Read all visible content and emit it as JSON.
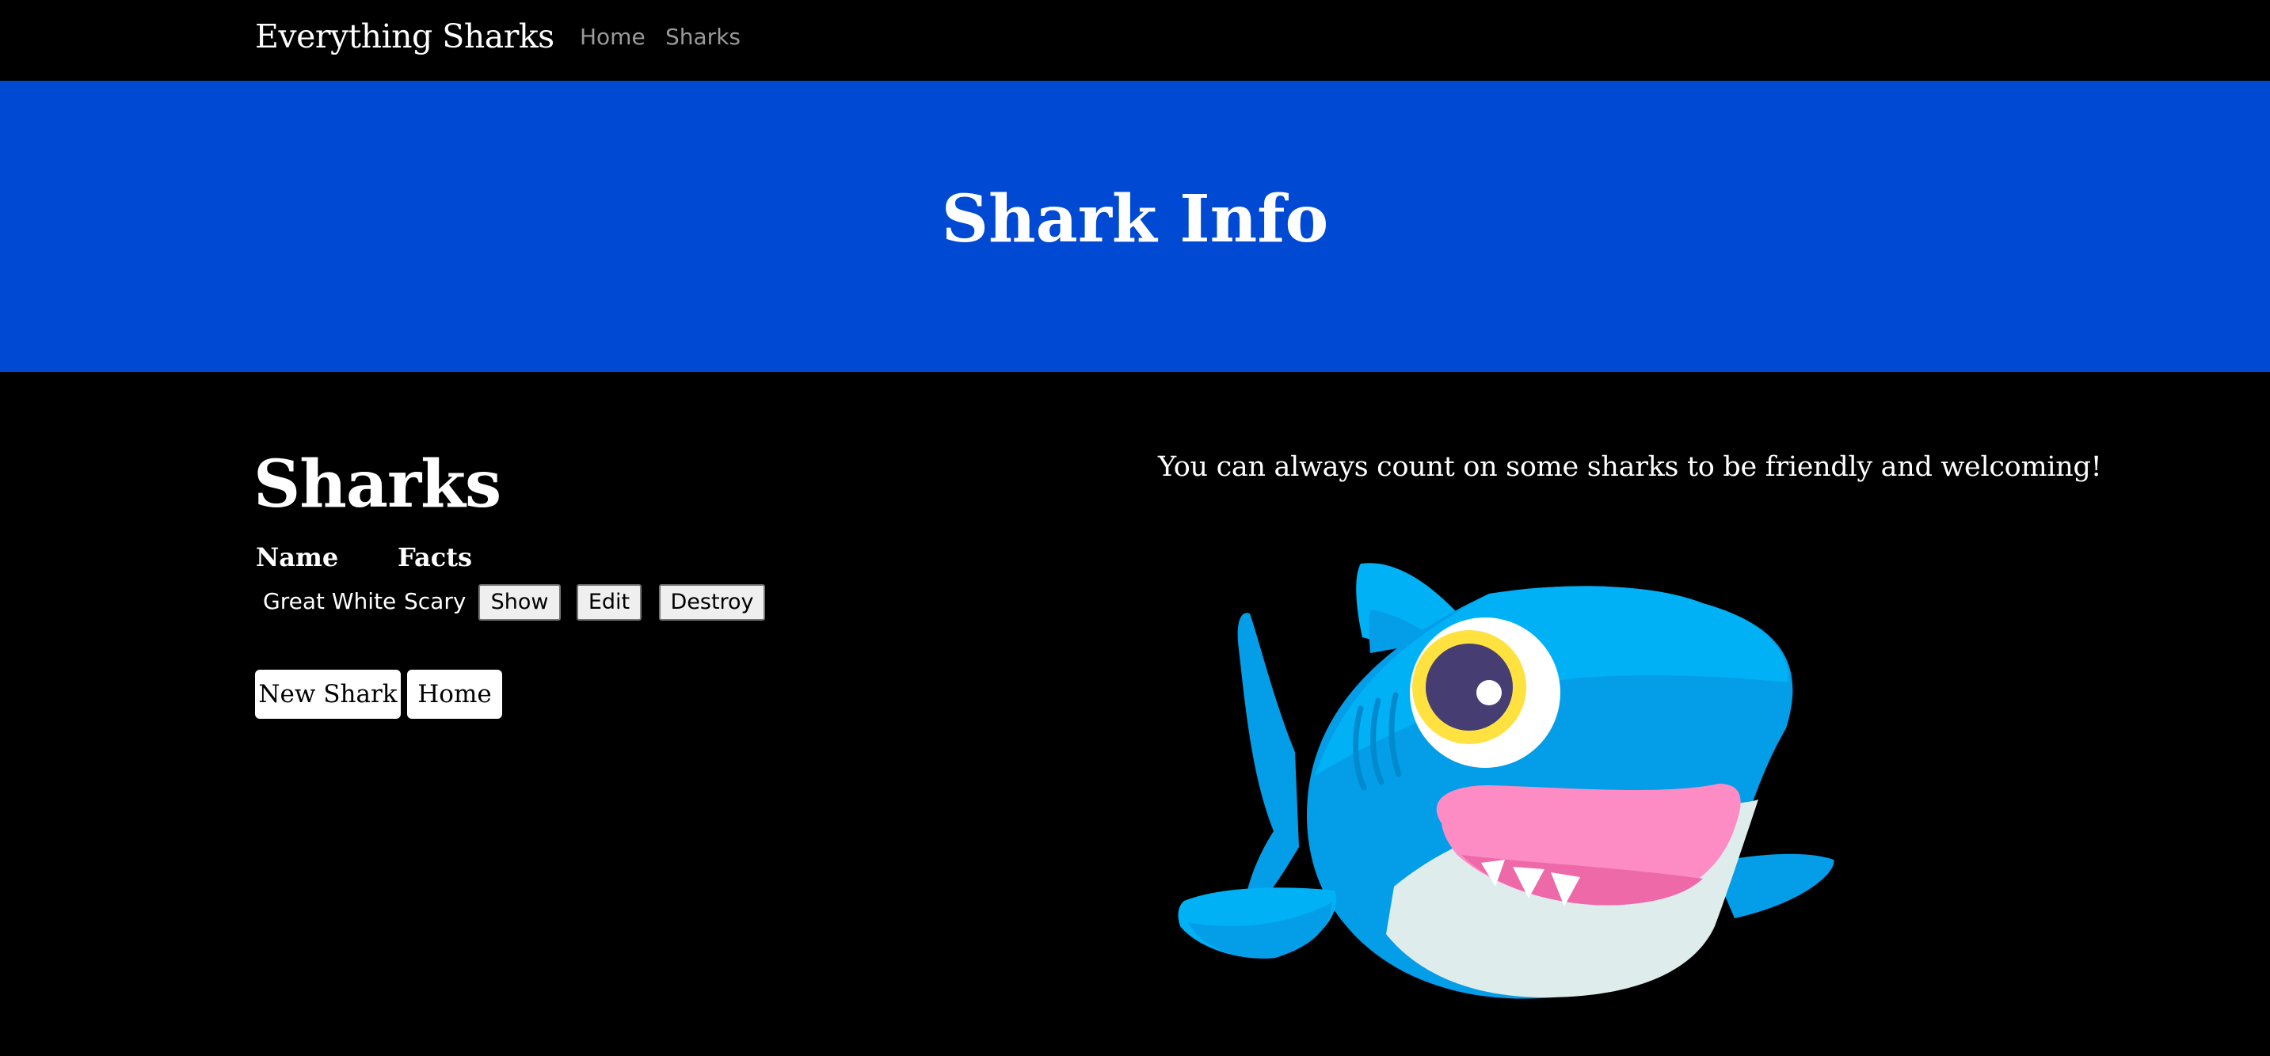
{
  "navbar": {
    "brand": "Everything Sharks",
    "links": [
      {
        "label": "Home"
      },
      {
        "label": "Sharks"
      }
    ]
  },
  "hero": {
    "title": "Shark Info"
  },
  "main": {
    "heading": "Sharks",
    "table": {
      "headers": [
        "Name",
        "Facts"
      ],
      "rows": [
        {
          "name": "Great White",
          "facts": "Scary",
          "actions": [
            "Show",
            "Edit",
            "Destroy"
          ]
        }
      ]
    },
    "buttons": {
      "new_shark": "New Shark",
      "home": "Home"
    }
  },
  "aside": {
    "tagline": "You can always count on some sharks to be friendly and welcoming!",
    "image_icon": "cartoon-shark-illustration"
  },
  "colors": {
    "background": "#000000",
    "hero": "#0049d2",
    "nav_link": "#9a9a9a",
    "shark_blue": "#049de8",
    "shark_light_blue": "#00b1f6",
    "shark_belly": "#deecec",
    "mouth_pink": "#fd8cc4",
    "eye_yellow": "#ffe140",
    "eye_purple": "#463d72"
  }
}
